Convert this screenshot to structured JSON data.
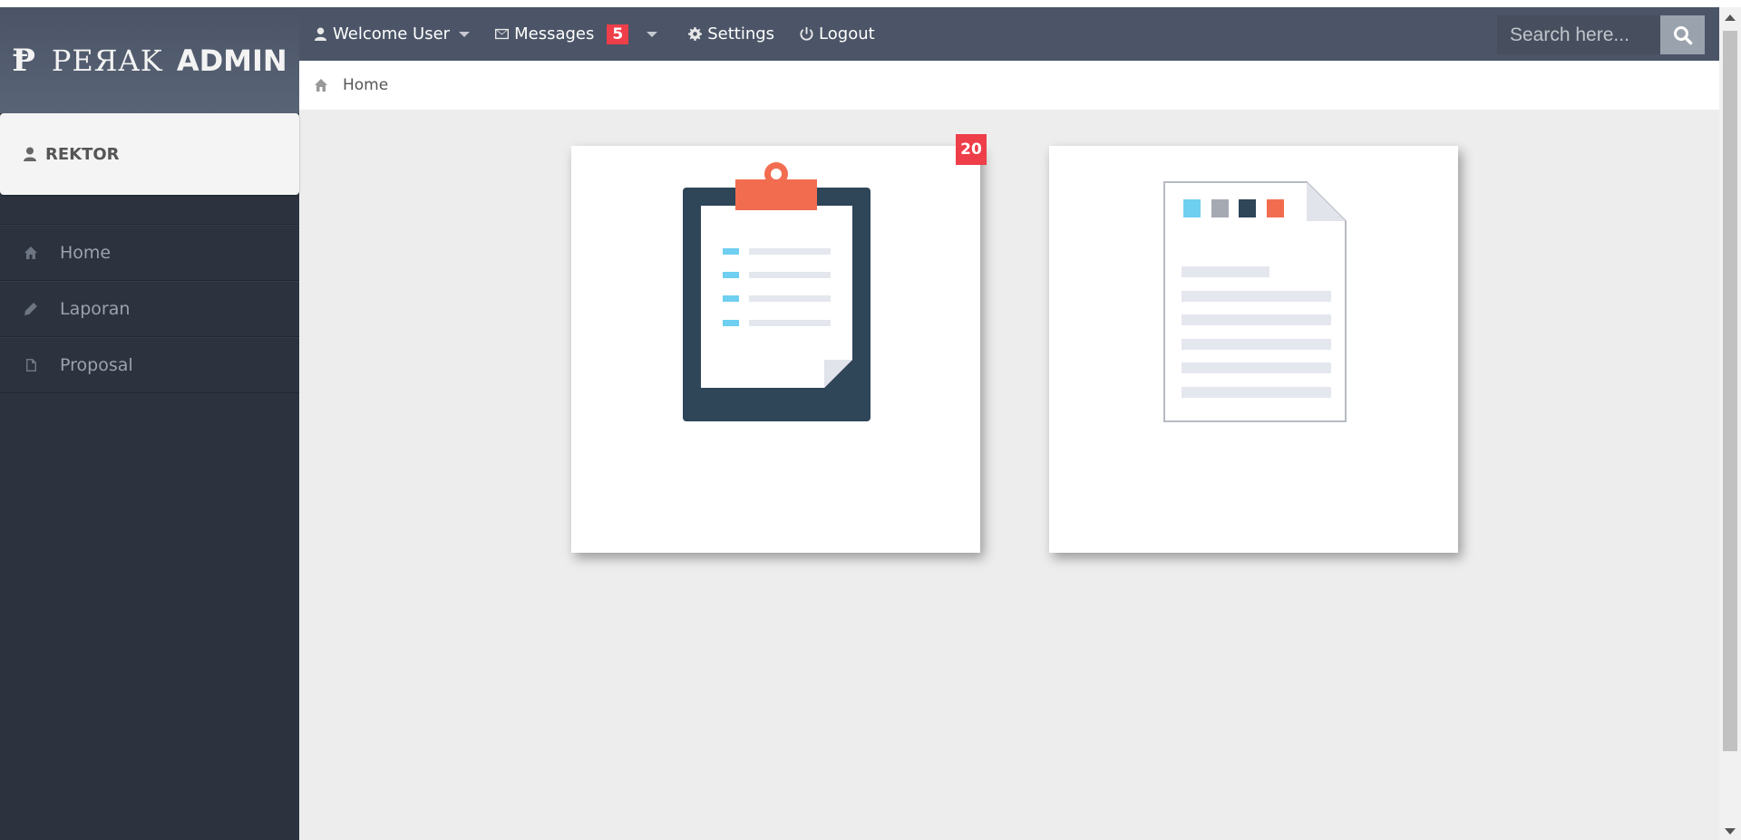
{
  "brand": {
    "mark": "Ᵽ",
    "name": "PEЯAK",
    "suffix": "ADMIN"
  },
  "user": {
    "role": "REKTOR"
  },
  "sidebar": {
    "items": [
      {
        "label": "Home",
        "icon": "home-icon"
      },
      {
        "label": "Laporan",
        "icon": "pencil-icon"
      },
      {
        "label": "Proposal",
        "icon": "file-icon"
      }
    ]
  },
  "topnav": {
    "welcome": "Welcome User",
    "messages": "Messages",
    "messages_count": "5",
    "settings": "Settings",
    "logout": "Logout"
  },
  "search": {
    "placeholder": "Search here..."
  },
  "breadcrumb": {
    "home": "Home"
  },
  "cards": {
    "laporan_badge": "20",
    "laporan_icon": "clipboard-icon",
    "proposal_icon": "document-icon"
  },
  "colors": {
    "sidebar": "#2c333f",
    "topnav": "#4b5567",
    "badge": "#ee3e4a",
    "accent_orange": "#f26d50",
    "accent_blue": "#6fcff0",
    "navy": "#2f4558"
  }
}
